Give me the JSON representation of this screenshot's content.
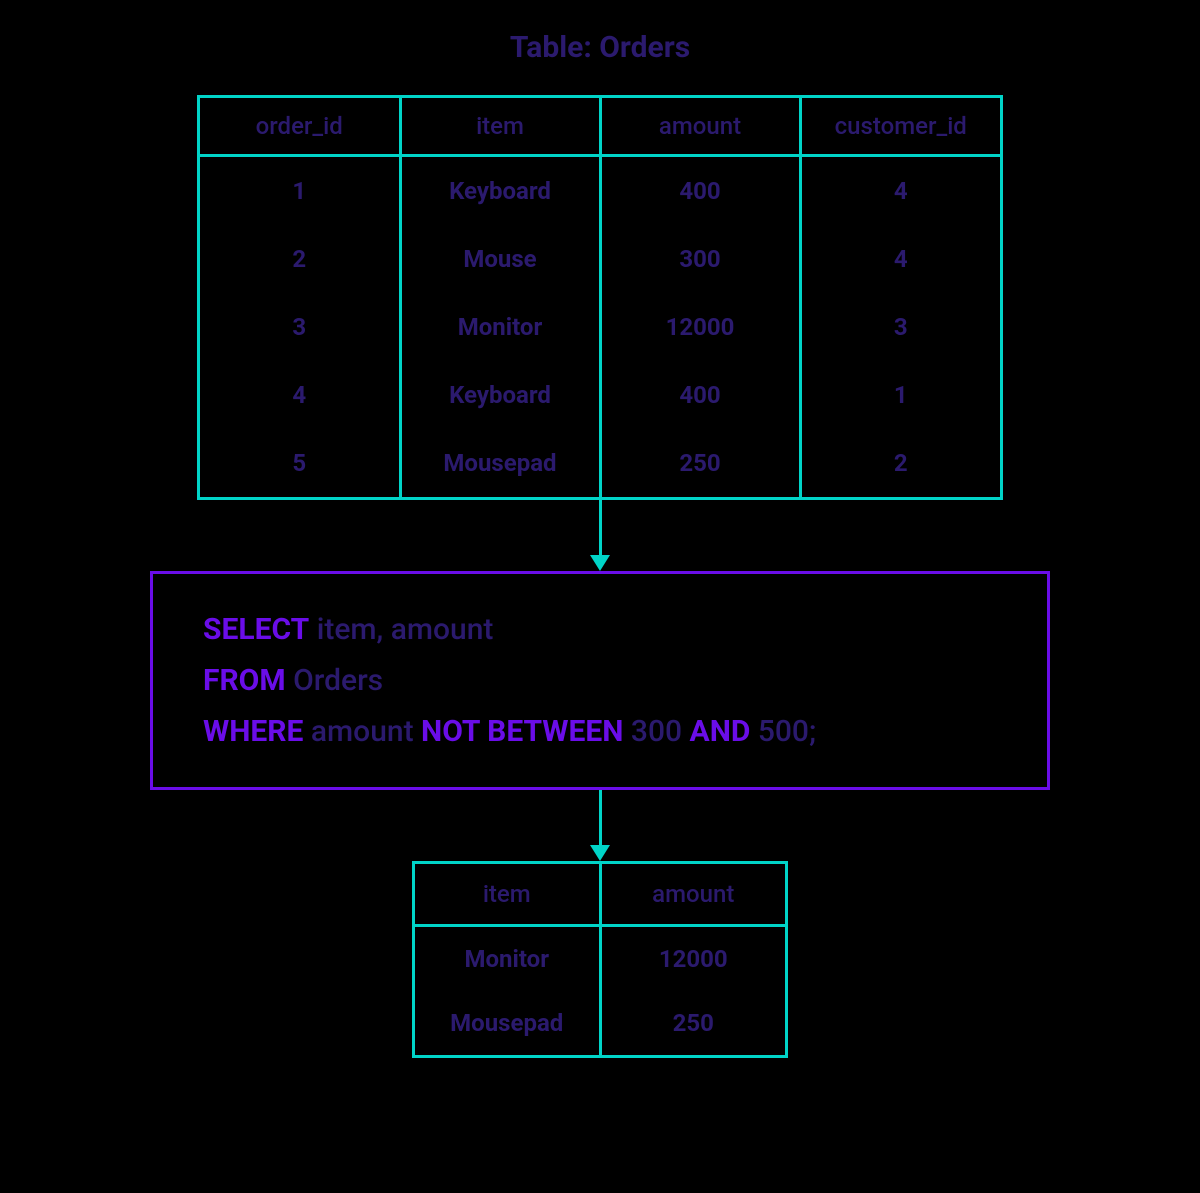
{
  "title": "Table: Orders",
  "orders": {
    "columns": [
      "order_id",
      "item",
      "amount",
      "customer_id"
    ],
    "rows": [
      [
        "1",
        "Keyboard",
        "400",
        "4"
      ],
      [
        "2",
        "Mouse",
        "300",
        "4"
      ],
      [
        "3",
        "Monitor",
        "12000",
        "3"
      ],
      [
        "4",
        "Keyboard",
        "400",
        "1"
      ],
      [
        "5",
        "Mousepad",
        "250",
        "2"
      ]
    ]
  },
  "sql": {
    "kw_select": "SELECT",
    "select_cols": " item, amount",
    "kw_from": "FROM",
    "from_table": " Orders",
    "kw_where": "WHERE",
    "where_col": " amount ",
    "kw_not_between": "NOT BETWEEN",
    "val1": " 300 ",
    "kw_and": "AND",
    "val2": " 500;"
  },
  "result": {
    "columns": [
      "item",
      "amount"
    ],
    "rows": [
      [
        "Monitor",
        "12000"
      ],
      [
        "Mousepad",
        "250"
      ]
    ]
  }
}
